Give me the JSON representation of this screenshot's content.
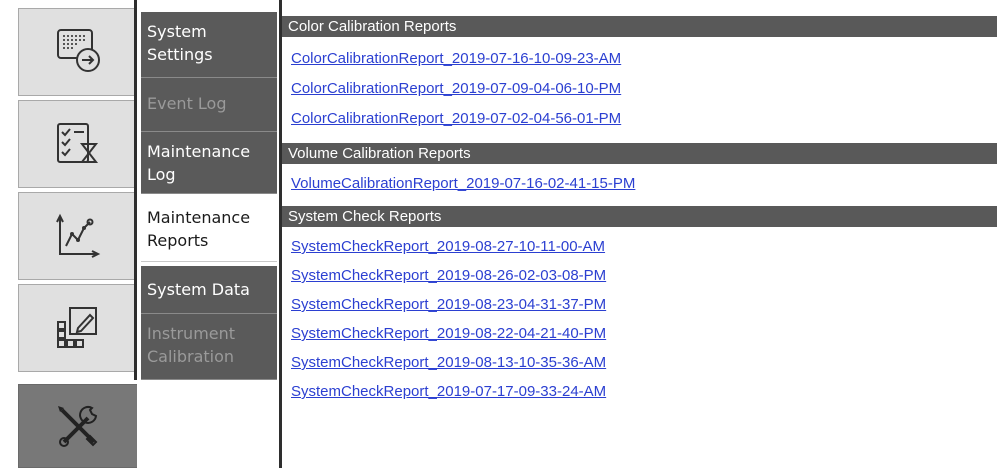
{
  "rail": {
    "items": [
      {
        "icon": "export-screen-icon",
        "active": false
      },
      {
        "icon": "checklist-hourglass-icon",
        "active": false
      },
      {
        "icon": "line-chart-icon",
        "active": false
      },
      {
        "icon": "grid-edit-icon",
        "active": false
      },
      {
        "icon": "tools-icon",
        "active": true
      }
    ]
  },
  "submenu": {
    "items": [
      {
        "label": "System Settings",
        "state": "normal"
      },
      {
        "label": "Event Log",
        "state": "disabled"
      },
      {
        "label": "Maintenance Log",
        "state": "normal"
      },
      {
        "label": "Maintenance Reports",
        "state": "selected"
      },
      {
        "label": "System Data",
        "state": "normal"
      },
      {
        "label": "Instrument Calibration",
        "state": "disabled"
      }
    ]
  },
  "sections": [
    {
      "title": "Color Calibration Reports",
      "reports": [
        "ColorCalibrationReport_2019-07-16-10-09-23-AM",
        "ColorCalibrationReport_2019-07-09-04-06-10-PM",
        "ColorCalibrationReport_2019-07-02-04-56-01-PM"
      ]
    },
    {
      "title": "Volume Calibration Reports",
      "reports": [
        "VolumeCalibrationReport_2019-07-16-02-41-15-PM"
      ]
    },
    {
      "title": "System Check Reports",
      "reports": [
        "SystemCheckReport_2019-08-27-10-11-00-AM",
        "SystemCheckReport_2019-08-26-02-03-08-PM",
        "SystemCheckReport_2019-08-23-04-31-37-PM",
        "SystemCheckReport_2019-08-22-04-21-40-PM",
        "SystemCheckReport_2019-08-13-10-35-36-AM",
        "SystemCheckReport_2019-07-17-09-33-24-AM"
      ]
    }
  ],
  "colors": {
    "section_header_bg": "#595959",
    "link": "#2b3fd1",
    "menu_bg": "#5a5a5a",
    "rail_active_bg": "#787878"
  }
}
